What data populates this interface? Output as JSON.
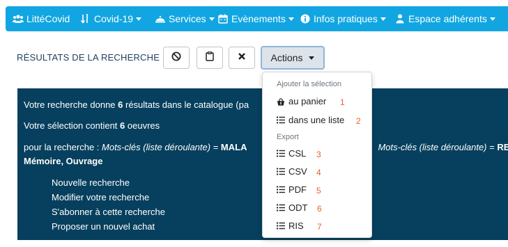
{
  "nav": {
    "items": [
      {
        "label": "LittéCovid",
        "icon": "users-icon",
        "caret": false
      },
      {
        "label": "Covid-19",
        "icon": "sort-icon",
        "caret": true
      },
      {
        "label": "Services",
        "icon": "bell-icon",
        "caret": true
      },
      {
        "label": "Evènements",
        "icon": "calendar-icon",
        "caret": true
      },
      {
        "label": "Infos pratiques",
        "icon": "info-circle-icon",
        "caret": true
      },
      {
        "label": "Espace adhérents",
        "icon": "user-icon",
        "caret": true
      }
    ]
  },
  "page": {
    "title": "RÉSULTATS DE LA RECHERCHE"
  },
  "toolbar": {
    "actions_label": "Actions"
  },
  "results": {
    "summary_pre": "Votre recherche donne ",
    "summary_count": "6",
    "summary_post": " résultats dans le catalogue (pa",
    "selection_pre": "Votre sélection contient ",
    "selection_count": "6",
    "selection_post": " oeuvres",
    "query_pre": "pour la recherche : ",
    "query_field": "Mots-clés (liste déroulante)",
    "query_eq": " = ",
    "query_value": "MALA",
    "query_field2": "Mots-clés (liste déroulante)",
    "query_eq2": " = ",
    "query_value2": "RE",
    "query_line2": "Mémoire, Ouvrage",
    "links": [
      "Nouvelle recherche",
      "Modifier votre recherche",
      "S'abonner à cette recherche",
      "Proposer un nouvel achat"
    ]
  },
  "dropdown": {
    "header_selection": "Ajouter la sélection",
    "header_export": "Export",
    "items": [
      {
        "label": "au panier",
        "icon": "basket-icon",
        "number": "1"
      },
      {
        "label": "dans une liste",
        "icon": "list-icon",
        "number": "2"
      },
      {
        "label": "CSL",
        "icon": "list-icon",
        "number": "3"
      },
      {
        "label": "CSV",
        "icon": "list-icon",
        "number": "4"
      },
      {
        "label": "PDF",
        "icon": "list-icon",
        "number": "5"
      },
      {
        "label": "ODT",
        "icon": "list-icon",
        "number": "6"
      },
      {
        "label": "RIS",
        "icon": "list-icon",
        "number": "7"
      }
    ]
  },
  "colors": {
    "navbar": "#11a6e2",
    "results_bg": "#07405e",
    "annotation": "#e9632b"
  }
}
